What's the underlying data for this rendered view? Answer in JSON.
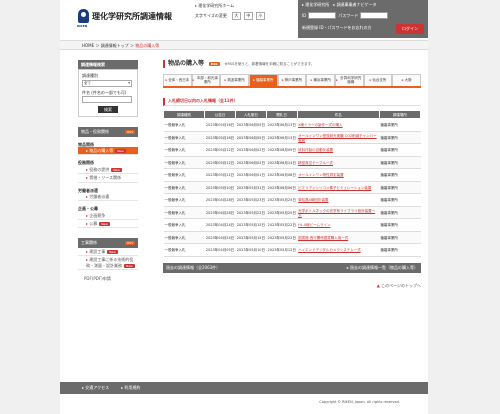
{
  "header": {
    "logo_text": "RIKEN",
    "title": "理化学研究所調達情報",
    "top_links": [
      "理化学研究所ホーム",
      "文字サイズの変更"
    ],
    "font_size_label": "文字サイズの変更",
    "font_sizes": [
      "大",
      "中",
      "小"
    ],
    "login": {
      "links": [
        "理化学研究所",
        "調達事業者ナビゲータ"
      ],
      "id_label": "ID",
      "password_label": "パスワード",
      "forgot_label": "新規登録",
      "remember_label": "ID・パスワードをお忘れの方",
      "login_button": "ログイン"
    }
  },
  "breadcrumb": {
    "items": [
      "HOME",
      "調達情報トップ"
    ],
    "current": "物品の購入等"
  },
  "sidebar": {
    "search_title": "調達情報検索",
    "category_label": "調達種別",
    "category_value": "全て",
    "keyword_label": "件名",
    "keyword_hint": "(件名の一部でも可)",
    "search_button": "検索",
    "cat_bar_label": "物品・役務関係",
    "cat_bar_rss": "RSS",
    "groups": [
      {
        "title": "物品関係",
        "items": [
          {
            "label": "物品の購入等",
            "new": true,
            "active": true
          }
        ]
      },
      {
        "title": "役務関係",
        "items": [
          {
            "label": "役務の提供",
            "new": true,
            "active": false
          },
          {
            "label": "賃借・リース関係",
            "new": false,
            "active": false
          }
        ]
      },
      {
        "title": "労働者派遣",
        "items": [
          {
            "label": "労働者派遣",
            "new": false,
            "active": false
          }
        ]
      },
      {
        "title": "企画・公募",
        "items": [
          {
            "label": "企画競争",
            "new": false,
            "active": false
          },
          {
            "label": "公募",
            "new": true,
            "active": false
          }
        ]
      }
    ],
    "koji_bar_label": "工事関係",
    "koji_bar_rss": "RSS",
    "koji_items": [
      {
        "label": "建設工事",
        "new": true
      },
      {
        "label": "建設工事に係る技術的役務・測量・設計業務",
        "new": true
      }
    ],
    "pdf_label": "PDF(PDF)申請"
  },
  "main": {
    "title": "物品の購入等",
    "rss": "RSS",
    "note": "※RSSを使うと、新着情報を手軽に知ることができます。",
    "tabs": [
      "全体・西日本",
      "本部・和光事業所",
      "筑波事業所",
      "播磨事業所",
      "神戸事業所",
      "横浜事業所",
      "計算科学研究機構",
      "仙台支所",
      "大阪"
    ],
    "active_tab": 3,
    "section_title": "入札締切日以内の入札情報（全11件）",
    "columns": [
      "調達種別",
      "公告日",
      "入札期日",
      "開札日",
      "件名",
      "調達場所"
    ],
    "rows": [
      [
        "一般競争入札",
        "2023年05月16日",
        "2023年06月05日",
        "2023年06月13日",
        "X線ミラーの製作一式の購入",
        "播磨事業所"
      ],
      [
        "一般競争入札",
        "2023年05月16日",
        "2023年06月05日",
        "2023年06月13日",
        "オールインワン型放射光実験 CO2削減チャンバー装置",
        "播磨事業所"
      ],
      [
        "一般競争入札",
        "2023年05月12日",
        "2023年06月02日",
        "2023年06月09日",
        "試料作製の自動化装置",
        "播磨事業所"
      ],
      [
        "一般競争入札",
        "2023年05月12日",
        "2023年06月02日",
        "2023年06月14日",
        "精密真空テーブル一式",
        "播磨事業所"
      ],
      [
        "一般競争入札",
        "2023年05月11日",
        "2023年06月01日",
        "2023年06月08日",
        "オールインワン物性測定装置",
        "播磨事業所"
      ],
      [
        "一般競争入札",
        "2023年05月10日",
        "2023年05月31日",
        "2023年06月06日",
        "ビミリアンシリコン素子ビミュレーション装置",
        "播磨事業所"
      ],
      [
        "一般競争入札",
        "2023年04月28日",
        "2023年05月23日",
        "2023年05月25日",
        "単結晶X線回折装置",
        "播磨事業所"
      ],
      [
        "一般競争入札",
        "2023年04月28日",
        "2023年05月22日",
        "2023年05月25日",
        "光学ボトルネックの光学系ライブラリ設計装置一式",
        "播磨事業所"
      ],
      [
        "一般競争入札",
        "2023年04月24日",
        "2023年05月15日",
        "2023年05月22日",
        "HL-X線ビームライン",
        "播磨事業所"
      ],
      [
        "一般競争入札",
        "2023年04月24日",
        "2023年05月15日",
        "2023年05月22日",
        "図書館 西行関係図書購入用一式",
        "播磨事業所"
      ],
      [
        "一般競争入札",
        "2023年04月05日",
        "2023年05月10日",
        "2023年05月12日",
        "ハイエンドデジタルカメラシステム一式",
        "播磨事業所"
      ]
    ],
    "past_label": "過去の調達情報（全2063件）",
    "past_link": "過去の調達情報一覧（物品の購入等）",
    "to_top": "このページのトップへ"
  },
  "footer": {
    "links": [
      "交通アクセス",
      "利用規約"
    ],
    "copyright": "Copyright © RIKEN, Japan. All rights reserved."
  }
}
